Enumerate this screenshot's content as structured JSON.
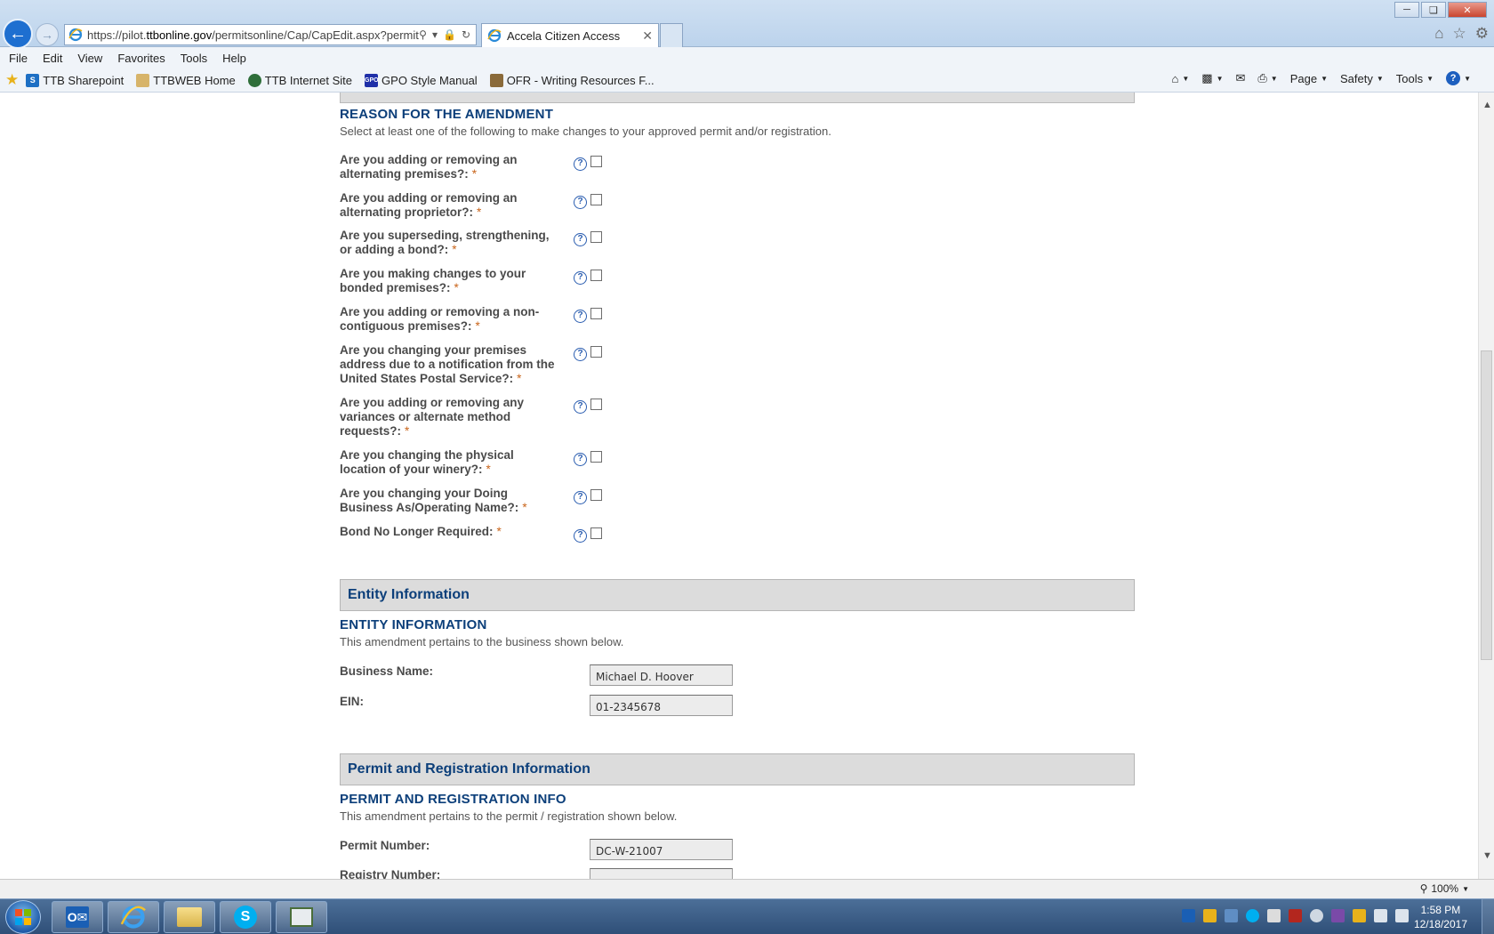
{
  "browser": {
    "url_prefix": "https://pilot.",
    "url_domain": "ttbonline.gov",
    "url_path": "/permitsonline/Cap/CapEdit.aspx?permitTyp",
    "tab_title": "Accela Citizen Access",
    "menu": [
      "File",
      "Edit",
      "View",
      "Favorites",
      "Tools",
      "Help"
    ],
    "favorites": [
      {
        "label": "TTB Sharepoint",
        "color": "#1d6fc4",
        "glyph": "S"
      },
      {
        "label": "TTBWEB Home",
        "color": "#d7b46a",
        "glyph": ""
      },
      {
        "label": "TTB Internet Site",
        "color": "#2f6e3a",
        "glyph": ""
      },
      {
        "label": "GPO Style Manual",
        "color": "#1f2fa8",
        "glyph": "GPO"
      },
      {
        "label": "OFR - Writing Resources F...",
        "color": "#8a6a3a",
        "glyph": ""
      }
    ],
    "commands": {
      "page": "Page",
      "safety": "Safety",
      "tools": "Tools"
    },
    "zoom": "100%"
  },
  "amendment": {
    "title": "REASON FOR THE AMENDMENT",
    "description": "Select at least one of the following to make changes to your approved permit and/or registration.",
    "questions": [
      {
        "line1": "Are you adding or removing an",
        "line2": "alternating premises?:",
        "line3": ""
      },
      {
        "line1": "Are you adding or removing an",
        "line2": "alternating proprietor?:",
        "line3": ""
      },
      {
        "line1": "Are you superseding, strengthening,",
        "line2": "or adding a bond?:",
        "line3": ""
      },
      {
        "line1": "Are you making changes to your",
        "line2": "bonded premises?:",
        "line3": ""
      },
      {
        "line1": "Are you adding or removing a non-",
        "line2": "contiguous premises?:",
        "line3": ""
      },
      {
        "line1": "Are you changing your premises",
        "line2": "address due to a notification from the",
        "line3": "United States Postal Service?:"
      },
      {
        "line1": "Are you adding or removing any",
        "line2": "variances or alternate method",
        "line3": "requests?:"
      },
      {
        "line1": "Are you changing the physical",
        "line2": "location of your winery?:",
        "line3": ""
      },
      {
        "line1": "Are you changing your Doing",
        "line2": "Business As/Operating Name?:",
        "line3": ""
      },
      {
        "line1": "Bond No Longer Required:",
        "line2": "",
        "line3": ""
      }
    ],
    "required_mark": "*",
    "help_glyph": "?"
  },
  "entity": {
    "header": "Entity Information",
    "title": "ENTITY INFORMATION",
    "description": "This amendment pertains to the business shown below.",
    "business_name_label": "Business Name:",
    "business_name_value": "Michael D. Hoover",
    "ein_label": "EIN:",
    "ein_value": "01-2345678"
  },
  "permit": {
    "header": "Permit and Registration Information",
    "title": "PERMIT AND REGISTRATION INFO",
    "description": "This amendment pertains to the permit / registration shown below.",
    "permit_number_label": "Permit Number:",
    "permit_number_value": "DC-W-21007",
    "registry_number_label": "Registry Number:"
  },
  "taskbar": {
    "clock_time": "1:58 PM",
    "clock_date": "12/18/2017"
  }
}
